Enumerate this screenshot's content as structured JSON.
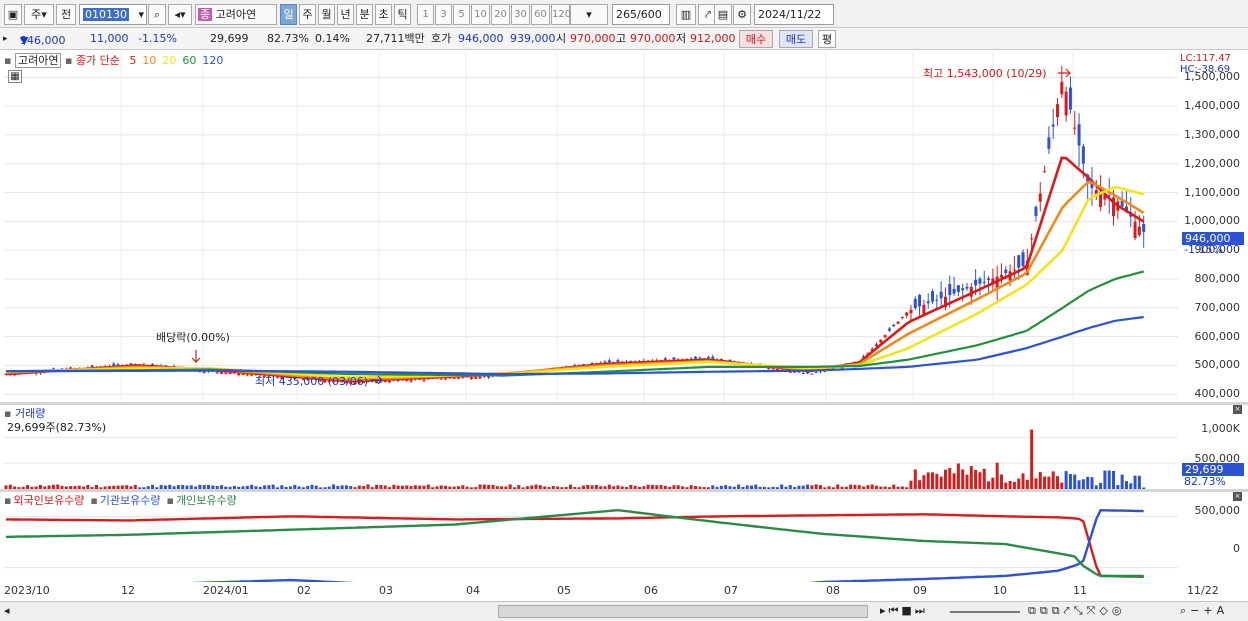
{
  "toolbar": {
    "market_a": "주",
    "market_b": "전",
    "code": "010130",
    "search_icon": "search-icon",
    "stock_name": "고려아연",
    "stock_badge": "종",
    "periods": [
      "일",
      "주",
      "월",
      "년",
      "분",
      "초",
      "틱"
    ],
    "intervals": [
      "1",
      "3",
      "5",
      "10",
      "20",
      "30",
      "60",
      "120"
    ],
    "count": "265",
    "count_max": "/600",
    "date": "2024/11/22"
  },
  "quote": {
    "price": "946,000",
    "arrow": "▼",
    "change": "11,000",
    "change_pct": "-1.15%",
    "volume": "29,699",
    "vol_ratio": "82.73%",
    "turnover_pct": "0.14%",
    "amount": "27,711백만",
    "bid_label": "호가",
    "bid": "946,000",
    "ask": "939,000",
    "open_label": "시",
    "open": "970,000",
    "high_label": "고",
    "high": "970,000",
    "low_label": "저",
    "low": "912,000",
    "buy_label": "매수",
    "sell_label": "매도",
    "eval_label": "평"
  },
  "price_panel": {
    "name": "고려아연",
    "ma_label": "종가 단순",
    "ma_periods": [
      "5",
      "10",
      "20",
      "60",
      "120"
    ],
    "ma_colors": [
      "#d81b1b",
      "#ee8a1a",
      "#f5e41a",
      "#21913a",
      "#2c53d6"
    ],
    "lc": "LC:117.47",
    "hc": "HC:-38.69",
    "high_note": "최고 1,543,000 (10/29)",
    "low_note": "최저 435,000 (03/06)",
    "div_note": "배당락(0.00%)",
    "last_price": "946,000",
    "last_pct": "-1.15%",
    "yticks": [
      "1,500,000",
      "1,400,000",
      "1,300,000",
      "1,200,000",
      "1,100,000",
      "1,000,000",
      "900,000",
      "800,000",
      "700,000",
      "600,000",
      "500,000",
      "400,000"
    ]
  },
  "volume_panel": {
    "name": "거래량",
    "readout": "29,699주(82.73%)",
    "yticks": [
      "1,000K",
      "500,000"
    ],
    "last": "29,699",
    "last_pct": "82.73%"
  },
  "holdings_panel": {
    "series": [
      "외국인보유수량",
      "기관보유수량",
      "개인보유수량"
    ],
    "colors": [
      "#d81b1b",
      "#2c53d6",
      "#2a8a4a"
    ],
    "yticks": [
      "500,000",
      "0"
    ]
  },
  "xaxis": [
    "2023/10",
    "12",
    "2024/01",
    "02",
    "03",
    "04",
    "05",
    "06",
    "07",
    "08",
    "09",
    "10",
    "11",
    "11/22"
  ],
  "chart_data": {
    "type": "line",
    "title": "고려아연",
    "series": [
      {
        "name": "종가",
        "x": [
          "2023/10",
          "2023/12",
          "2024/01",
          "2024/03",
          "2024/05",
          "2024/06",
          "2024/07",
          "2024/08",
          "2024/09",
          "2024/09/13",
          "2024/10/04",
          "2024/10/18",
          "2024/10/29",
          "2024/11/05",
          "2024/11/12",
          "2024/11/22"
        ],
        "values": [
          470000,
          505000,
          480000,
          440000,
          465000,
          510000,
          525000,
          470000,
          510000,
          690000,
          780000,
          850000,
          1500000,
          1120000,
          1080000,
          946000
        ]
      },
      {
        "name": "5",
        "values": [
          470000,
          500000,
          485000,
          445000,
          470000,
          505000,
          520000,
          480000,
          510000,
          650000,
          760000,
          840000,
          1230000,
          1150000,
          1060000,
          990000
        ]
      },
      {
        "name": "10",
        "values": [
          475000,
          495000,
          488000,
          450000,
          472000,
          500000,
          515000,
          485000,
          505000,
          610000,
          730000,
          820000,
          1050000,
          1140000,
          1090000,
          1020000
        ]
      },
      {
        "name": "20",
        "values": [
          478000,
          490000,
          490000,
          458000,
          470000,
          495000,
          512000,
          490000,
          500000,
          560000,
          680000,
          780000,
          900000,
          1080000,
          1120000,
          1090000
        ]
      },
      {
        "name": "60",
        "values": [
          480000,
          483000,
          486000,
          470000,
          465000,
          478000,
          495000,
          495000,
          498000,
          520000,
          570000,
          620000,
          700000,
          760000,
          800000,
          830000
        ]
      },
      {
        "name": "120",
        "values": [
          480000,
          481000,
          482000,
          478000,
          470000,
          472000,
          478000,
          482000,
          488000,
          495000,
          520000,
          560000,
          600000,
          630000,
          655000,
          670000
        ]
      }
    ],
    "ylim": [
      380000,
      1560000
    ],
    "high": {
      "label": "최고",
      "value": 1543000,
      "date": "10/29"
    },
    "low": {
      "label": "최저",
      "value": 435000,
      "date": "03/06"
    },
    "volume": {
      "ylim": [
        0,
        1200000
      ],
      "last": 29699
    },
    "holdings": {
      "series": [
        {
          "name": "외국인보유수량",
          "values": [
            470,
            460,
            500,
            470,
            480,
            500,
            510,
            520,
            500,
            490,
            480,
            470,
            -80,
            -90
          ]
        },
        {
          "name": "기관보유수량",
          "values": [
            -160,
            -170,
            -120,
            -200,
            -230,
            -230,
            -140,
            -110,
            -80,
            -30,
            20,
            50,
            560,
            550
          ]
        },
        {
          "name": "개인보유수량",
          "values": [
            300,
            320,
            370,
            420,
            560,
            440,
            330,
            260,
            230,
            140,
            110,
            20,
            -80,
            -80
          ]
        }
      ],
      "ylim": [
        -120,
        620
      ]
    }
  }
}
